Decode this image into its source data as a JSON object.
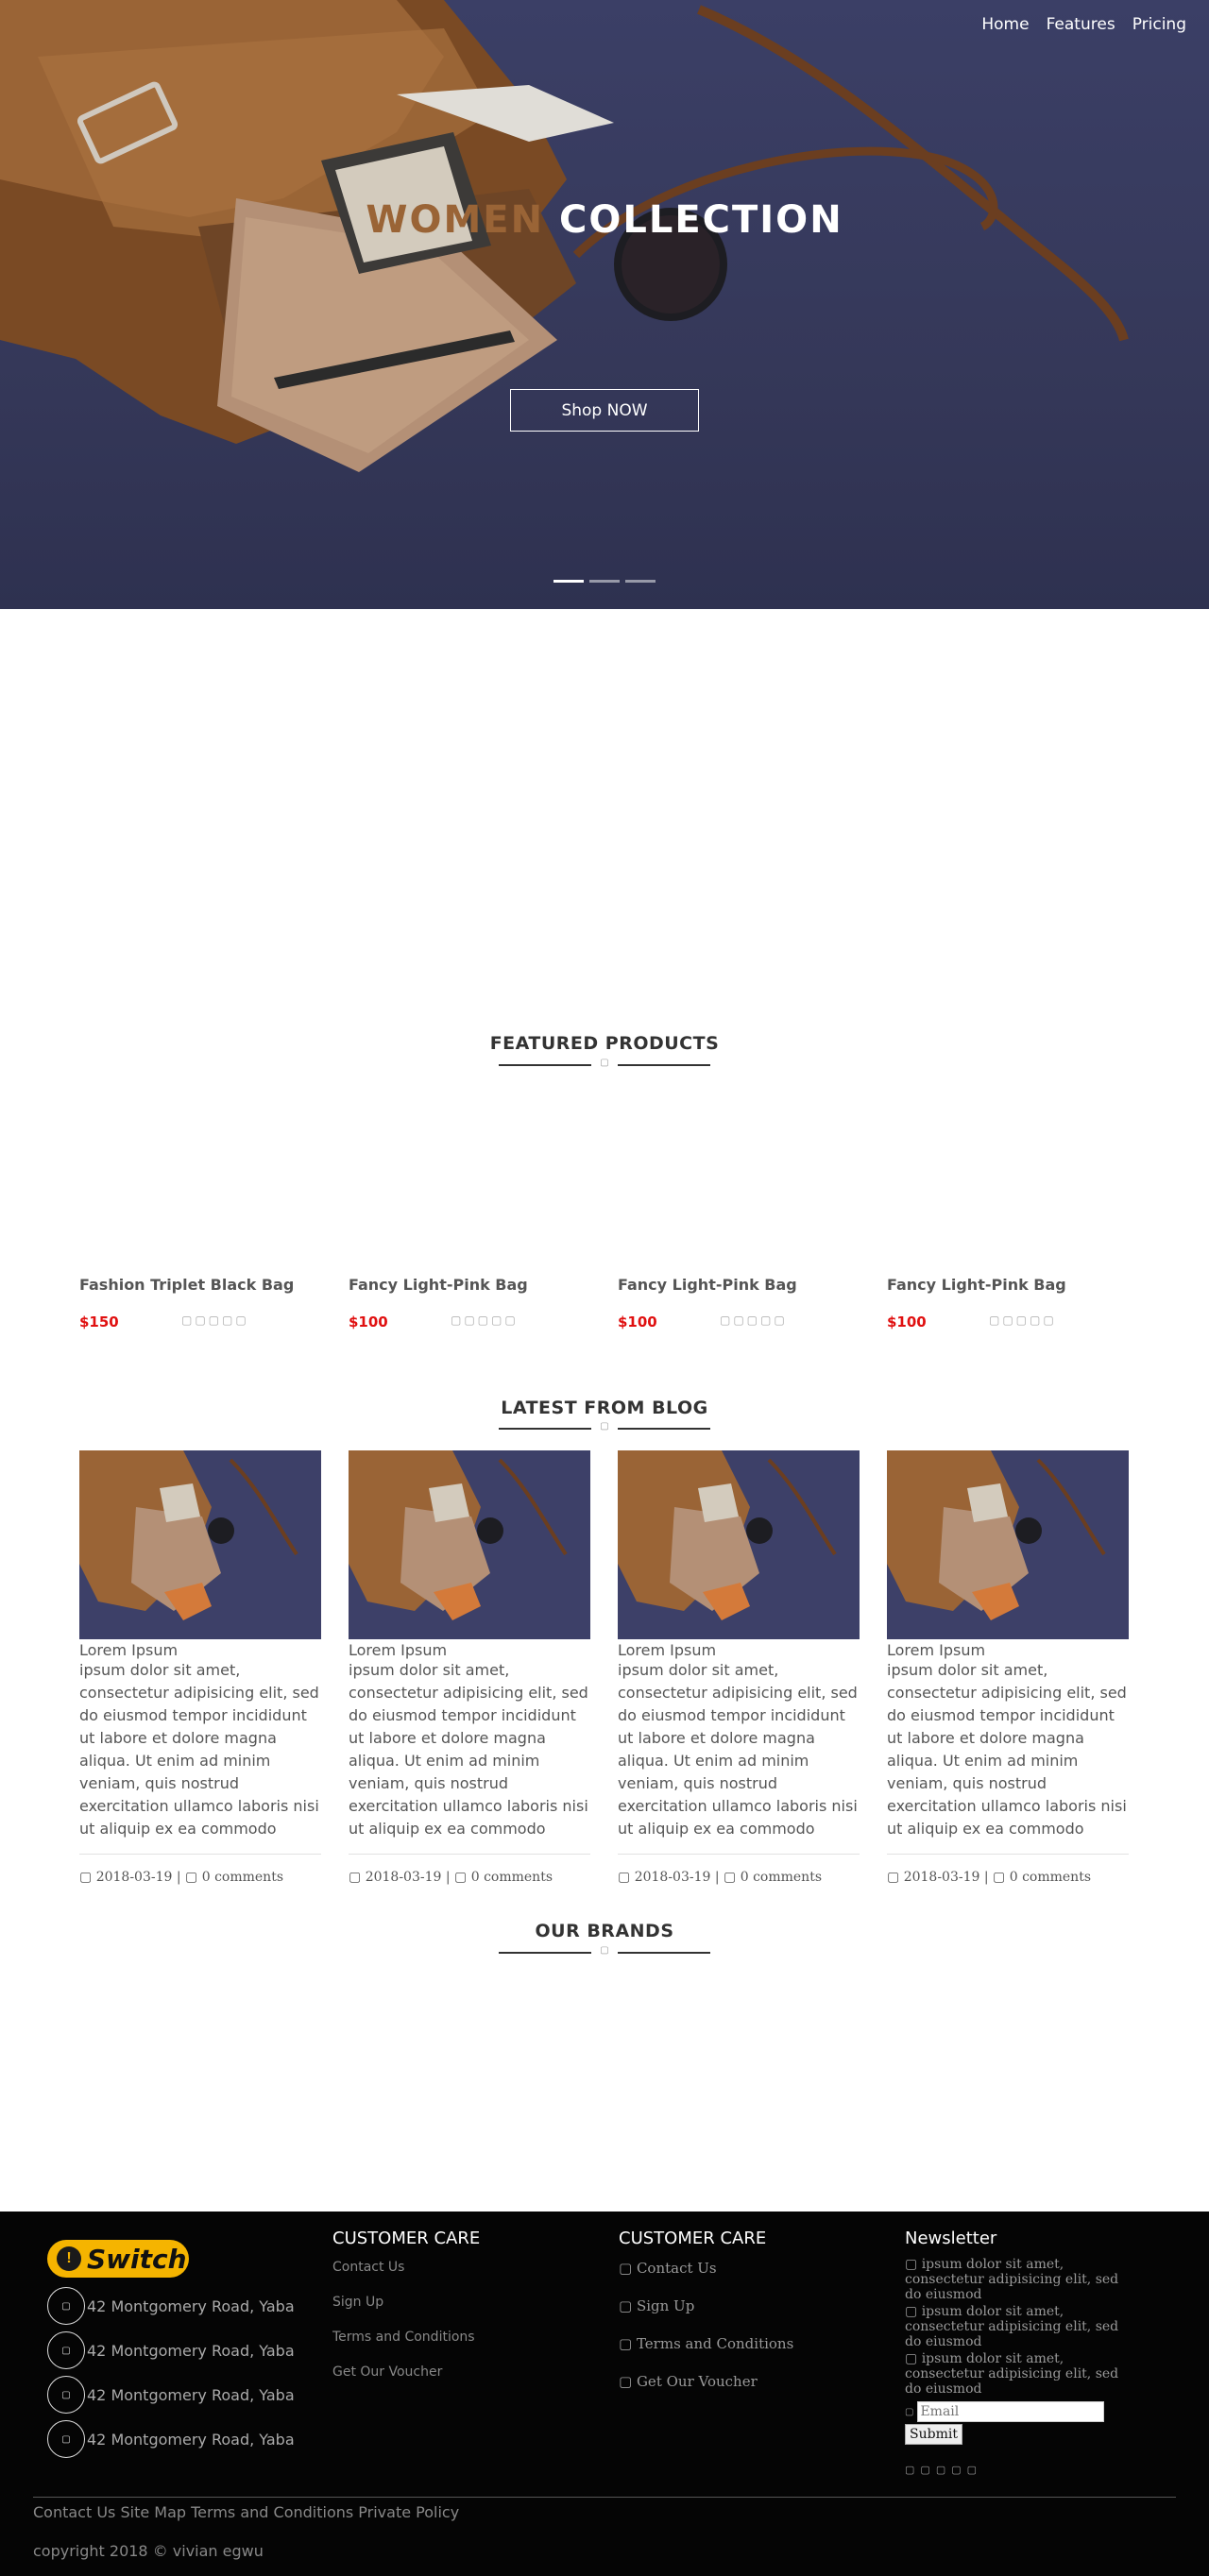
{
  "nav": {
    "items": [
      "Home",
      "Features",
      "Pricing"
    ]
  },
  "hero": {
    "title_part1": "WOMEN",
    "title_part2": "COLLECTION",
    "button_label": "Shop NOW",
    "slides_total": 3,
    "active_slide": 1
  },
  "featured": {
    "title": "FEATURED PRODUCTS",
    "icon": "diamond-icon",
    "products": [
      {
        "name": "Fashion Triplet Black Bag",
        "price": "$150",
        "rating_stars": 5
      },
      {
        "name": "Fancy Light-Pink Bag",
        "price": "$100",
        "rating_stars": 5
      },
      {
        "name": "Fancy Light-Pink Bag",
        "price": "$100",
        "rating_stars": 5
      },
      {
        "name": "Fancy Light-Pink Bag",
        "price": "$100",
        "rating_stars": 5
      }
    ]
  },
  "blog": {
    "title": "LATEST FROM BLOG",
    "posts": [
      {
        "title": "Lorem Ipsum",
        "body": "ipsum dolor sit amet, consectetur adipisicing elit, sed do eiusmod tempor incididunt ut labore et dolore magna aliqua. Ut enim ad minim veniam, quis nostrud exercitation ullamco laboris nisi ut aliquip ex ea commodo",
        "date": "2018-03-19",
        "comments": "0 comments"
      },
      {
        "title": "Lorem Ipsum",
        "body": "ipsum dolor sit amet, consectetur adipisicing elit, sed do eiusmod tempor incididunt ut labore et dolore magna aliqua. Ut enim ad minim veniam, quis nostrud exercitation ullamco laboris nisi ut aliquip ex ea commodo",
        "date": "2018-03-19",
        "comments": "0 comments"
      },
      {
        "title": "Lorem Ipsum",
        "body": "ipsum dolor sit amet, consectetur adipisicing elit, sed do eiusmod tempor incididunt ut labore et dolore magna aliqua. Ut enim ad minim veniam, quis nostrud exercitation ullamco laboris nisi ut aliquip ex ea commodo",
        "date": "2018-03-19",
        "comments": "0 comments"
      },
      {
        "title": "Lorem Ipsum",
        "body": "ipsum dolor sit amet, consectetur adipisicing elit, sed do eiusmod tempor incididunt ut labore et dolore magna aliqua. Ut enim ad minim veniam, quis nostrud exercitation ullamco laboris nisi ut aliquip ex ea commodo",
        "date": "2018-03-19",
        "comments": "0 comments"
      }
    ]
  },
  "brands": {
    "title": "OUR BRANDS"
  },
  "footer": {
    "logo_text": "Switch",
    "addresses": [
      "42 Montgomery Road, Yaba",
      "42 Montgomery Road, Yaba",
      "42 Montgomery Road, Yaba",
      "42 Montgomery Road, Yaba"
    ],
    "care1": {
      "title": "CUSTOMER CARE",
      "links": [
        "Contact Us",
        "Sign Up",
        "Terms and Conditions",
        "Get Our Voucher"
      ]
    },
    "care2": {
      "title": "CUSTOMER CARE",
      "links": [
        "Contact Us",
        "Sign Up",
        "Terms and Conditions",
        "Get Our Voucher"
      ]
    },
    "newsletter": {
      "title": "Newsletter",
      "items": [
        "ipsum dolor sit amet, consectetur adipisicing elit, sed do eiusmod",
        "ipsum dolor sit amet, consectetur adipisicing elit, sed do eiusmod",
        "ipsum dolor sit amet, consectetur adipisicing elit, sed do eiusmod"
      ],
      "email_placeholder": "Email",
      "submit_label": "Submit"
    },
    "bottom_links": "Contact Us Site Map Terms and Conditions Private Policy",
    "copyright": "copyright 2018 © vivian egwu"
  },
  "colors": {
    "hero_bg": "#353859",
    "accent_brown": "#9a6436",
    "price_red": "#e01010",
    "footer_bg": "#050505",
    "logo_yellow": "#f5b400"
  }
}
